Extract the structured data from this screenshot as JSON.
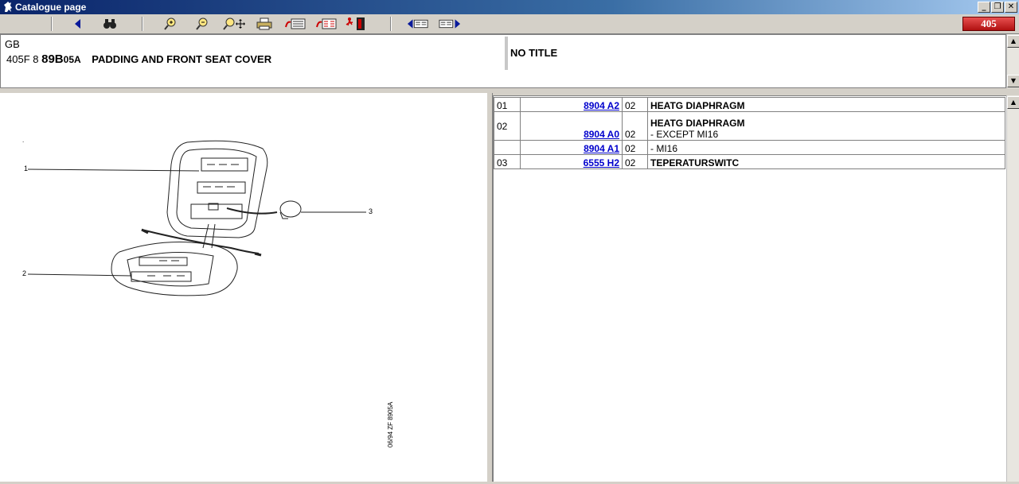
{
  "window": {
    "title": "Catalogue page"
  },
  "toolbar": {
    "buttons": [
      {
        "name": "back-button",
        "icon": "arrow-left-icon"
      },
      {
        "name": "search-button",
        "icon": "binoculars-icon"
      },
      {
        "name": "zoom-in-button",
        "icon": "zoom-in-icon"
      },
      {
        "name": "zoom-out-button",
        "icon": "zoom-out-icon"
      },
      {
        "name": "zoom-move-button",
        "icon": "zoom-pan-icon"
      },
      {
        "name": "print-button",
        "icon": "printer-icon"
      },
      {
        "name": "list-view-button",
        "icon": "list-icon"
      },
      {
        "name": "grid-view-button",
        "icon": "grid-icon"
      },
      {
        "name": "exit-button",
        "icon": "exit-door-icon"
      },
      {
        "name": "prev-page-button",
        "icon": "page-prev-icon"
      },
      {
        "name": "next-page-button",
        "icon": "page-next-icon"
      }
    ],
    "model_badge": "405"
  },
  "header": {
    "language": "GB",
    "model_code": "405F 8",
    "group_big": "89B",
    "group_small": "05A",
    "description": "PADDING AND FRONT SEAT COVER",
    "right_title": "NO TITLE"
  },
  "diagram": {
    "callouts": [
      "1",
      "2",
      "3"
    ],
    "reference": "06/94  ZF  8905A"
  },
  "parts": {
    "rows": [
      {
        "index": "01",
        "ref": "8904 A2",
        "qty": "02",
        "desc_bold": "HEATG DIAPHRAGM",
        "desc_note": ""
      },
      {
        "index": "02",
        "ref": "8904 A0",
        "qty": "02",
        "desc_bold": "HEATG DIAPHRAGM",
        "desc_note": "- EXCEPT MI16"
      },
      {
        "index": "",
        "ref": "8904 A1",
        "qty": "02",
        "desc_bold": "",
        "desc_note": "- MI16"
      },
      {
        "index": "03",
        "ref": "6555 H2",
        "qty": "02",
        "desc_bold": "TEPERATURSWITC",
        "desc_note": ""
      }
    ]
  },
  "colors": {
    "titlebar_start": "#0a246a",
    "link": "#0000cc",
    "badge": "#c82020"
  }
}
